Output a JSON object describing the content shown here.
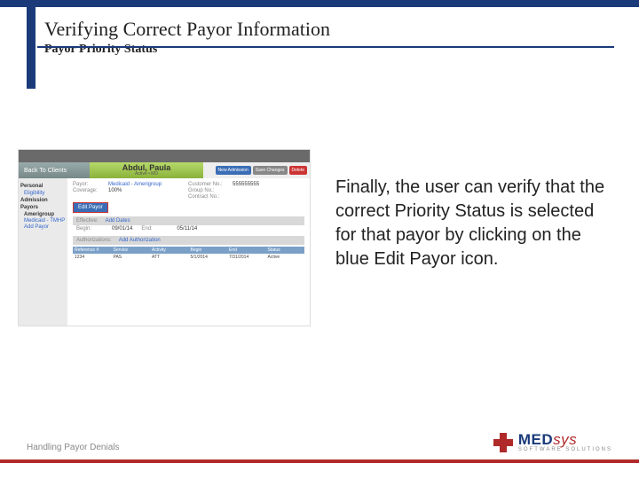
{
  "header": {
    "title": "Verifying Correct Payor Information",
    "subtitle": "Payor Priority Status"
  },
  "body_text": "Finally, the user can verify that the correct Priority Status is selected for that payor by clicking on the blue Edit Payor icon.",
  "footer": "Handling Payor Denials",
  "logo": {
    "brand": "MED",
    "brand2": "sys",
    "tagline": "SOFTWARE SOLUTIONS"
  },
  "app": {
    "back": "Back To Clients",
    "patient": {
      "name": "Abdul, Paula",
      "id": "Active • MD"
    },
    "buttons": {
      "new_admission": "New Admission",
      "save": "Save Changes",
      "delete": "Delete"
    },
    "sidebar": {
      "personal": "Personal",
      "eligibility": "Eligibility",
      "admission": "Admission",
      "payors": "Payors",
      "amerigroup": "Amerigroup",
      "medicaid": "Medicaid - TMHP",
      "add_payor": "Add Payor"
    },
    "details": {
      "payor_lbl": "Payor:",
      "payor_val": "Medicaid - Amerigroup",
      "cov_lbl": "Coverage:",
      "cov_val": "100%",
      "cust_lbl": "Customer No.:",
      "cust_val": "555555555",
      "group_lbl": "Group No.:",
      "group_val": "",
      "contract_lbl": "Contract No.:",
      "contract_val": "",
      "edit_payor": "Edit Payor",
      "eff_lbl": "Effective:",
      "add_dates": "Add Dates",
      "begin_lbl": "Begin:",
      "begin_val": "09/01/14",
      "end_lbl": "End:",
      "end_val": "05/11/14",
      "auth_lbl": "Authorizations:",
      "add_auth": "Add Authorization"
    },
    "table": {
      "h1": "Reference #",
      "h2": "Service",
      "h3": "Activity",
      "h4": "Begin",
      "h5": "End",
      "h6": "Status",
      "r": {
        "c1": "1234",
        "c2": "PAS",
        "c3": "ATT",
        "c4": "5/1/2014",
        "c5": "7/31/2014",
        "c6": "Active"
      }
    }
  }
}
